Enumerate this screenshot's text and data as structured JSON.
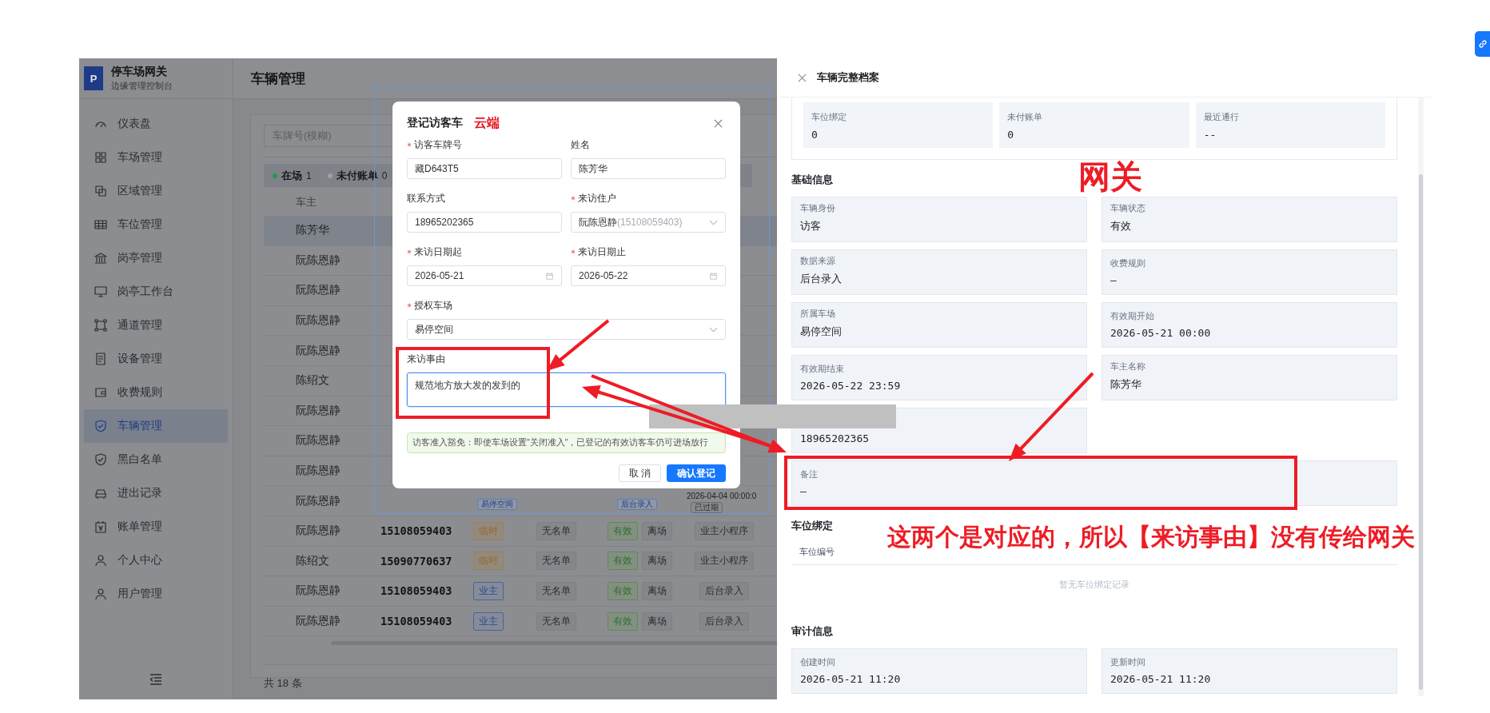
{
  "app": {
    "logo_letter": "P",
    "title": "停车场网关",
    "subtitle": "边缘管理控制台"
  },
  "sidebar": {
    "items": [
      {
        "label": "仪表盘",
        "selected": false
      },
      {
        "label": "车场管理",
        "selected": false
      },
      {
        "label": "区域管理",
        "selected": false
      },
      {
        "label": "车位管理",
        "selected": false
      },
      {
        "label": "岗亭管理",
        "selected": false
      },
      {
        "label": "岗亭工作台",
        "selected": false
      },
      {
        "label": "通道管理",
        "selected": false
      },
      {
        "label": "设备管理",
        "selected": false
      },
      {
        "label": "收费规则",
        "selected": false
      },
      {
        "label": "车辆管理",
        "selected": true
      },
      {
        "label": "黑白名单",
        "selected": false
      },
      {
        "label": "进出记录",
        "selected": false
      },
      {
        "label": "账单管理",
        "selected": false
      },
      {
        "label": "个人中心",
        "selected": false
      },
      {
        "label": "用户管理",
        "selected": false
      }
    ]
  },
  "page_title": "车辆管理",
  "table": {
    "search": {
      "placeholder": "车牌号(模糊)"
    },
    "stats": [
      {
        "label": "在场",
        "count": "1",
        "color": "#1f9a4a"
      },
      {
        "label": "未付账单",
        "count": "0",
        "color": "#9ea2a8"
      }
    ],
    "columns": [
      "车主"
    ],
    "rows": [
      {
        "owner": "陈芳华",
        "selected": true
      },
      {
        "owner": "阮陈恩静",
        "selected": false
      },
      {
        "owner": "阮陈恩静",
        "selected": false
      },
      {
        "owner": "阮陈恩静",
        "selected": false
      },
      {
        "owner": "阮陈恩静",
        "selected": false
      },
      {
        "owner": "陈绍文",
        "selected": false
      },
      {
        "owner": "阮陈恩静",
        "selected": false
      },
      {
        "owner": "阮陈恩静",
        "selected": false
      },
      {
        "owner": "阮陈恩静",
        "selected": false
      },
      {
        "owner": "阮陈恩静",
        "selected": false
      },
      {
        "owner": "阮陈恩静",
        "selected": false,
        "phone": "15108059403",
        "tags": [
          {
            "text": "临时",
            "kind": "temp"
          },
          {
            "text": "无名单",
            "kind": "neutral"
          },
          {
            "text": "有效",
            "kind": "success"
          },
          {
            "text": "离场",
            "kind": "neutral"
          },
          {
            "text": "业主小程序",
            "kind": "neutral"
          }
        ]
      },
      {
        "owner": "陈绍文",
        "selected": false,
        "phone": "15090770637",
        "tags": [
          {
            "text": "临时",
            "kind": "temp"
          },
          {
            "text": "无名单",
            "kind": "neutral"
          },
          {
            "text": "有效",
            "kind": "success"
          },
          {
            "text": "离场",
            "kind": "neutral"
          },
          {
            "text": "业主小程序",
            "kind": "neutral"
          }
        ]
      },
      {
        "owner": "阮陈恩静",
        "selected": false,
        "phone": "15108059403",
        "tags": [
          {
            "text": "业主",
            "kind": "owner"
          },
          {
            "text": "无名单",
            "kind": "neutral"
          },
          {
            "text": "有效",
            "kind": "success"
          },
          {
            "text": "离场",
            "kind": "neutral"
          },
          {
            "text": "后台录入",
            "kind": "neutral"
          }
        ]
      },
      {
        "owner": "阮陈恩静",
        "selected": false,
        "phone": "15108059403",
        "tags": [
          {
            "text": "业主",
            "kind": "owner"
          },
          {
            "text": "无名单",
            "kind": "neutral"
          },
          {
            "text": "有效",
            "kind": "success"
          },
          {
            "text": "离场",
            "kind": "neutral"
          },
          {
            "text": "后台录入",
            "kind": "neutral"
          }
        ]
      }
    ],
    "footer": "共 18 条"
  },
  "background_dialog": {
    "items": [
      {
        "text": "易停空间",
        "kind": "tag"
      },
      {
        "text": "后台录入",
        "kind": "tag"
      },
      {
        "text": "2026-04-04 00:00:0",
        "kind": "text"
      },
      {
        "text": "已过期",
        "kind": "tag"
      }
    ]
  },
  "modal": {
    "title": "登记访客车",
    "tag": "云端",
    "fields": [
      {
        "label": "访客车牌号",
        "required": true,
        "kind": "input",
        "value": "藏D643T5"
      },
      {
        "label": "姓名",
        "required": false,
        "kind": "input",
        "value": "陈芳华"
      },
      {
        "label": "联系方式",
        "required": false,
        "kind": "input",
        "value": "18965202365"
      },
      {
        "label": "来访住户",
        "required": true,
        "kind": "select",
        "value": "阮陈恩静",
        "hint": "(15108059403)"
      },
      {
        "label": "来访日期起",
        "required": true,
        "kind": "date",
        "value": "2026-05-21"
      },
      {
        "label": "来访日期止",
        "required": true,
        "kind": "date",
        "value": "2026-05-22"
      },
      {
        "label": "授权车场",
        "required": true,
        "kind": "select",
        "value": "易停空间",
        "wide": true
      },
      {
        "label": "来访事由",
        "required": false,
        "kind": "textarea",
        "value": "规范地方放大发的发到的",
        "wide": true,
        "focused": true
      }
    ],
    "notice": "访客准入豁免：即使车场设置\"关闭准入\"，已登记的有效访客车仍可进场放行",
    "buttons": [
      {
        "label": "取 消",
        "kind": "default"
      },
      {
        "label": "确认登记",
        "kind": "primary"
      }
    ]
  },
  "drawer": {
    "title": "车辆完整档案",
    "stats": [
      {
        "label": "车位绑定",
        "value": "0"
      },
      {
        "label": "未付账单",
        "value": "0"
      },
      {
        "label": "最近通行",
        "value": "--"
      }
    ],
    "sections": [
      {
        "title": "基础信息",
        "kind": "cards",
        "cards": [
          {
            "label": "车辆身份",
            "value": "访客"
          },
          {
            "label": "车辆状态",
            "value": "有效"
          },
          {
            "label": "数据来源",
            "value": "后台录入"
          },
          {
            "label": "收费规则",
            "value": "—"
          },
          {
            "label": "所属车场",
            "value": "易停空间"
          },
          {
            "label": "有效期开始",
            "value": "2026-05-21 00:00"
          },
          {
            "label": "有效期结束",
            "value": "2026-05-22 23:59"
          },
          {
            "label": "车主名称",
            "value": "陈芳华"
          },
          {
            "value": "18965202365"
          },
          {
            "label": "备注",
            "value": "—",
            "wide": true
          }
        ]
      },
      {
        "title": "车位绑定",
        "kind": "table",
        "columns": [
          "车位编号"
        ],
        "empty_text": "暂无车位绑定记录"
      },
      {
        "title": "审计信息",
        "kind": "cards",
        "cards": [
          {
            "label": "创建时间",
            "value": "2026-05-21 11:20"
          },
          {
            "label": "更新时间",
            "value": "2026-05-21 11:20"
          }
        ]
      }
    ]
  },
  "annotations": {
    "drawer_tag": "网关",
    "note": "这两个是对应的，所以【来访事由】没有传给网关"
  }
}
